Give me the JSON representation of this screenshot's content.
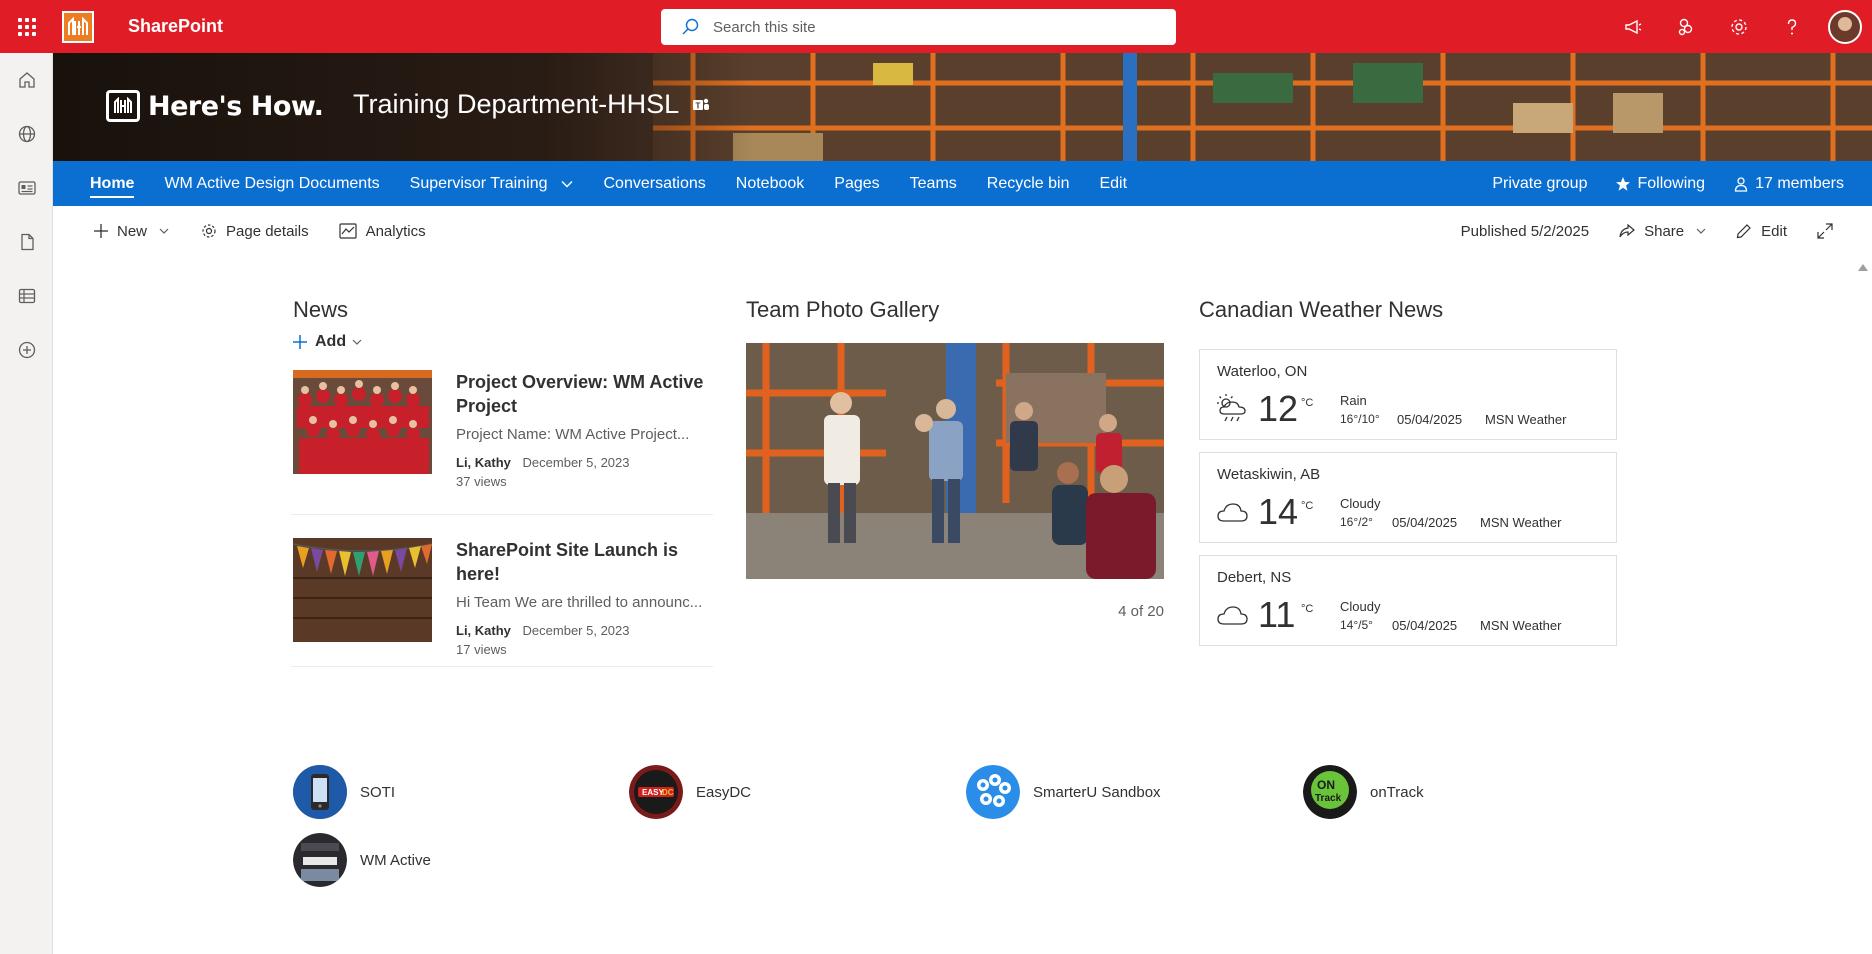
{
  "suite": {
    "app_name": "SharePoint",
    "brand_mark": "",
    "search_placeholder": "Search this site"
  },
  "header": {
    "logo_text": "Here's How.",
    "site_title": "Training Department-HHSL"
  },
  "nav": {
    "links": [
      {
        "label": "Home",
        "active": true
      },
      {
        "label": "WM Active Design Documents"
      },
      {
        "label": "Supervisor Training"
      },
      {
        "label": "Conversations"
      },
      {
        "label": "Notebook"
      },
      {
        "label": "Pages"
      },
      {
        "label": "Teams"
      },
      {
        "label": "Recycle bin"
      },
      {
        "label": "Edit"
      }
    ],
    "privacy": "Private group",
    "following": "Following",
    "members": "17 members"
  },
  "commands": {
    "new": "New",
    "page_details": "Page details",
    "analytics": "Analytics",
    "published": "Published 5/2/2025",
    "share": "Share",
    "edit": "Edit"
  },
  "news": {
    "title": "News",
    "add": "Add",
    "items": [
      {
        "title": "Project Overview: WM Active Project",
        "desc": "Project Name: WM Active Project...",
        "author": "Li, Kathy",
        "date": "December 5, 2023",
        "views": "37 views"
      },
      {
        "title": "SharePoint Site Launch is here!",
        "desc": "Hi Team We are thrilled to announc...",
        "author": "Li, Kathy",
        "date": "December 5, 2023",
        "views": "17 views"
      }
    ]
  },
  "gallery": {
    "title": "Team Photo Gallery",
    "count": "4 of 20"
  },
  "weather": {
    "title": "Canadian Weather News",
    "unit": "°C",
    "cards": [
      {
        "city": "Waterloo, ON",
        "temp": "12",
        "condition": "Rain",
        "range": "16°/10°",
        "date": "05/04/2025",
        "source": "MSN Weather",
        "icon": "rain-sun-icon"
      },
      {
        "city": "Wetaskiwin, AB",
        "temp": "14",
        "condition": "Cloudy",
        "range": "16°/2°",
        "date": "05/04/2025",
        "source": "MSN Weather",
        "icon": "cloud-icon"
      },
      {
        "city": "Debert, NS",
        "temp": "11",
        "condition": "Cloudy",
        "range": "14°/5°",
        "date": "05/04/2025",
        "source": "MSN Weather",
        "icon": "cloud-icon"
      }
    ]
  },
  "quick_links": [
    {
      "label": "SOTI"
    },
    {
      "label": "EasyDC"
    },
    {
      "label": "SmarterU Sandbox"
    },
    {
      "label": "onTrack"
    },
    {
      "label": "WM Active"
    }
  ],
  "colors": {
    "suite_bar": "#e01d26",
    "nav_bar": "#0b6fd1",
    "accent": "#0078d4"
  }
}
